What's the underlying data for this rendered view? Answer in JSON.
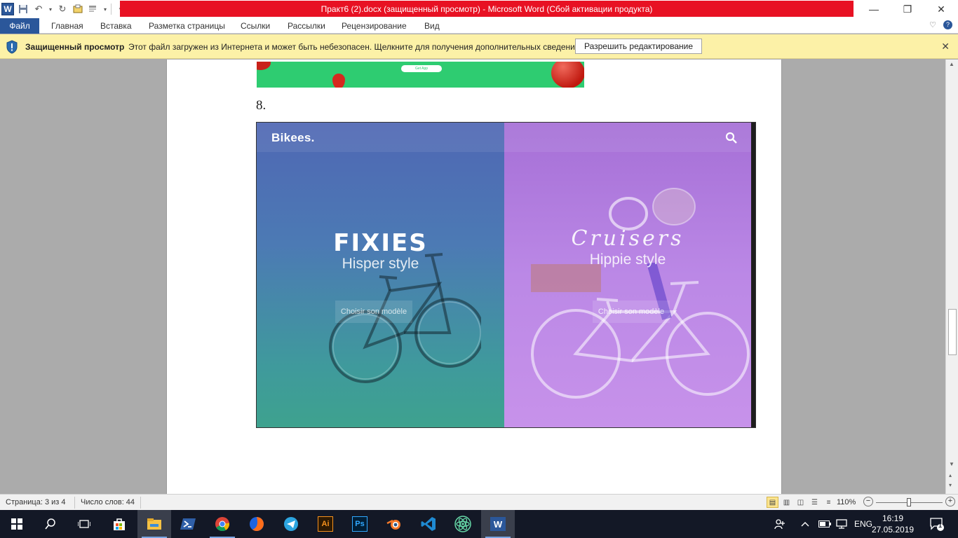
{
  "window": {
    "title": "Практ6 (2).docx (защищенный просмотр)  -  Microsoft Word (Сбой активации продукта)",
    "app_icon_letter": "W",
    "controls": {
      "minimize": "—",
      "maximize": "❐",
      "close": "✕"
    }
  },
  "ribbon": {
    "file_tab": "Файл",
    "tabs": [
      "Главная",
      "Вставка",
      "Разметка страницы",
      "Ссылки",
      "Рассылки",
      "Рецензирование",
      "Вид"
    ]
  },
  "protected_view": {
    "title": "Защищенный просмотр",
    "message": "Этот файл загружен из Интернета и может быть небезопасен. Щелкните для получения дополнительных сведений.",
    "enable_button": "Разрешить редактирование",
    "close": "✕"
  },
  "document": {
    "previous_image_button": "Get App",
    "paragraph_number": "8.",
    "embedded_site": {
      "logo": "Bikees.",
      "left": {
        "heading": "FIXIES",
        "subtitle": "Hisper style",
        "button": "Choisir son modèle"
      },
      "right": {
        "heading": "Cruisers",
        "subtitle": "Hippie style",
        "button": "Choisir son modèle"
      }
    }
  },
  "status_bar": {
    "page": "Страница: 3 из 4",
    "words": "Число слов: 44",
    "zoom": "110%",
    "zoom_minus": "−",
    "zoom_plus": "+"
  },
  "taskbar": {
    "language": "ENG",
    "time": "16:19",
    "date": "27.05.2019",
    "notification_count": "1",
    "apps": [
      "start-icon",
      "search-icon",
      "task-view-icon",
      "store-icon",
      "file-explorer-icon",
      "powershell-icon",
      "chrome-icon",
      "firefox-icon",
      "telegram-icon",
      "illustrator-icon",
      "photoshop-icon",
      "blender-icon",
      "vscode-icon",
      "atom-icon",
      "word-icon"
    ]
  },
  "colors": {
    "word_blue": "#2b579a",
    "title_red": "#e81123",
    "protected_bar": "#fcf1a7",
    "taskbar": "#131826"
  }
}
